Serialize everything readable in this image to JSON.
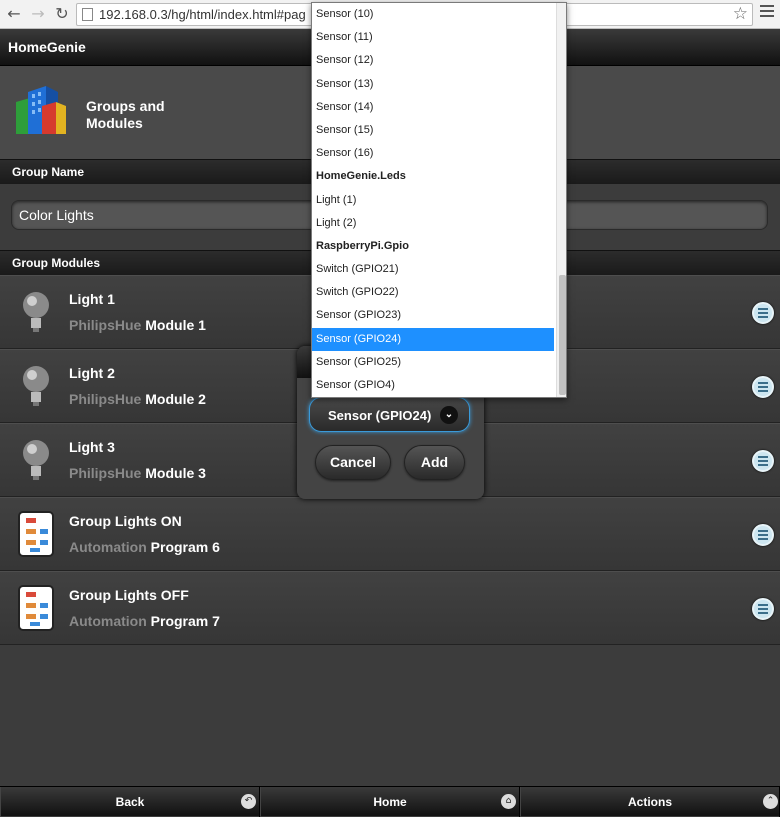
{
  "browser": {
    "url": "192.168.0.3/hg/html/index.html#pag",
    "back_icon": "arrow-left-icon",
    "forward_icon": "arrow-right-icon",
    "reload_icon": "reload-icon",
    "star_icon": "star-icon",
    "menu_icon": "hamburger-menu-icon"
  },
  "header": {
    "title": "HomeGenie"
  },
  "hero": {
    "title": "Groups and Modules",
    "icon": "buildings-icon"
  },
  "group_name": {
    "label": "Group Name",
    "value": "Color Lights"
  },
  "group_modules": {
    "label": "Group Modules",
    "rows": [
      {
        "title": "Light 1",
        "domain": "PhilipsHue",
        "address": "Module 1",
        "icon": "light-bulb-icon"
      },
      {
        "title": "Light 2",
        "domain": "PhilipsHue",
        "address": "Module 2",
        "icon": "light-bulb-icon"
      },
      {
        "title": "Light 3",
        "domain": "PhilipsHue",
        "address": "Module 3",
        "icon": "light-bulb-icon"
      },
      {
        "title": "Group Lights ON",
        "domain": "Automation",
        "address": "Program 6",
        "icon": "program-flowchart-icon"
      },
      {
        "title": "Group Lights OFF",
        "domain": "Automation",
        "address": "Program 7",
        "icon": "program-flowchart-icon"
      }
    ]
  },
  "popup": {
    "selected": "Sensor (GPIO24)",
    "cancel_label": "Cancel",
    "add_label": "Add"
  },
  "dropdown": {
    "items": [
      {
        "label": "Sensor (10)",
        "group": false,
        "selected": false
      },
      {
        "label": "Sensor (11)",
        "group": false,
        "selected": false
      },
      {
        "label": "Sensor (12)",
        "group": false,
        "selected": false
      },
      {
        "label": "Sensor (13)",
        "group": false,
        "selected": false
      },
      {
        "label": "Sensor (14)",
        "group": false,
        "selected": false
      },
      {
        "label": "Sensor (15)",
        "group": false,
        "selected": false
      },
      {
        "label": "Sensor (16)",
        "group": false,
        "selected": false
      },
      {
        "label": "HomeGenie.Leds",
        "group": true,
        "selected": false
      },
      {
        "label": "Light (1)",
        "group": false,
        "selected": false
      },
      {
        "label": "Light (2)",
        "group": false,
        "selected": false
      },
      {
        "label": "RaspberryPi.Gpio",
        "group": true,
        "selected": false
      },
      {
        "label": "Switch (GPIO21)",
        "group": false,
        "selected": false
      },
      {
        "label": "Switch (GPIO22)",
        "group": false,
        "selected": false
      },
      {
        "label": "Sensor (GPIO23)",
        "group": false,
        "selected": false
      },
      {
        "label": "Sensor (GPIO24)",
        "group": false,
        "selected": true
      },
      {
        "label": "Sensor (GPIO25)",
        "group": false,
        "selected": false
      },
      {
        "label": "Sensor (GPIO4)",
        "group": false,
        "selected": false
      }
    ]
  },
  "footer": {
    "back_label": "Back",
    "home_label": "Home",
    "actions_label": "Actions"
  },
  "colors": {
    "selection": "#1e90ff",
    "focus_ring": "#3a9ad9"
  }
}
